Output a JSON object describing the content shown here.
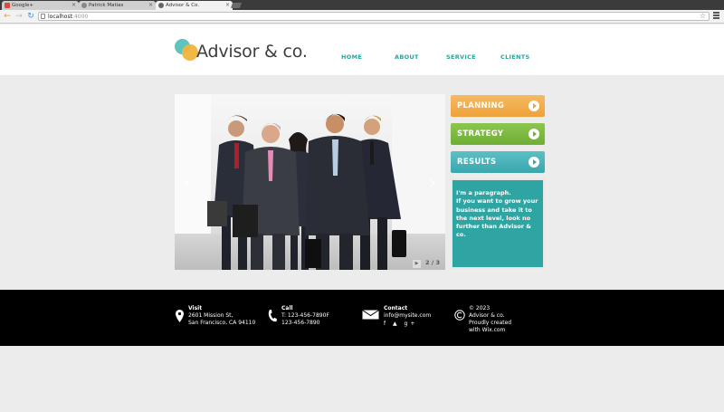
{
  "browser": {
    "tabs": [
      {
        "title": "Google+"
      },
      {
        "title": "Patrick Matias"
      },
      {
        "title": "Advisor & Co."
      }
    ],
    "url_host": "localhost",
    "url_port": ":4000"
  },
  "header": {
    "logo_text": "Advisor & co.",
    "nav": [
      "HOME",
      "ABOUT",
      "SERVICE",
      "CLIENTS"
    ]
  },
  "slider": {
    "counter": "2 / 3",
    "prev_glyph": "‹",
    "next_glyph": "›",
    "play_glyph": "▶"
  },
  "side_buttons": [
    "PLANNING",
    "STRATEGY",
    "RESULTS"
  ],
  "paragraph": {
    "line1": "I'm a paragraph.",
    "line2": "If you want to grow your business and take it to the next level, look no further than Advisor & co."
  },
  "footer": {
    "visit": {
      "title": "Visit",
      "line1": "2601 Mission St,",
      "line2": "San Francisco, CA 94110"
    },
    "call": {
      "title": "Call",
      "line1": "T: 123-456-7890F",
      "line2": "123-456-7890"
    },
    "contact": {
      "title": "Contact",
      "line1": "info@mysite.com",
      "social": "f ▲ g+"
    },
    "copyright": {
      "line1": "© 2023",
      "line2": "Advisor & co.",
      "line3": "Proudly created",
      "line4": "with Wix.com"
    }
  },
  "colors": {
    "teal": "#2fa5a3",
    "orange": "#eea23a",
    "green": "#6fae35",
    "nav": "#2aa39c"
  }
}
